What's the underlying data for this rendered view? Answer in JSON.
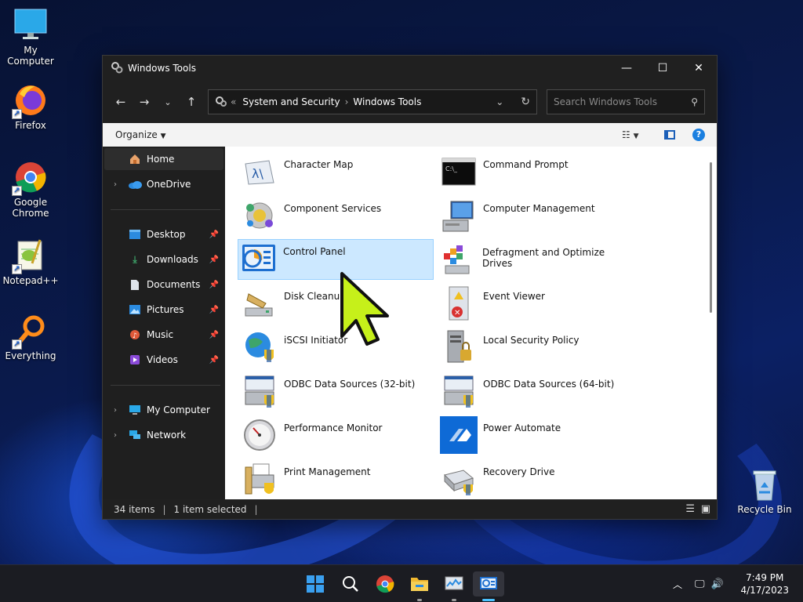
{
  "desktop": {
    "icons": [
      {
        "label": "My Computer"
      },
      {
        "label": "Firefox"
      },
      {
        "label": "Google Chrome"
      },
      {
        "label": "Notepad++"
      },
      {
        "label": "Everything"
      },
      {
        "label": "Recycle Bin"
      }
    ]
  },
  "window": {
    "title": "Windows Tools",
    "address": {
      "prefix": "«",
      "crumbs": [
        "System and Security",
        "Windows Tools"
      ]
    },
    "search_placeholder": "Search Windows Tools",
    "organize_label": "Organize",
    "nav": {
      "home": "Home",
      "onedrive": "OneDrive",
      "desktop": "Desktop",
      "downloads": "Downloads",
      "documents": "Documents",
      "pictures": "Pictures",
      "music": "Music",
      "videos": "Videos",
      "mycomputer": "My Computer",
      "network": "Network"
    },
    "items": [
      {
        "label": "Character Map",
        "icon": "character-map-icon"
      },
      {
        "label": "Command Prompt",
        "icon": "command-prompt-icon"
      },
      {
        "label": "Component Services",
        "icon": "component-services-icon"
      },
      {
        "label": "Computer Management",
        "icon": "computer-management-icon"
      },
      {
        "label": "Control Panel",
        "icon": "control-panel-icon",
        "selected": true
      },
      {
        "label": "Defragment and Optimize Drives",
        "icon": "defragment-icon"
      },
      {
        "label": "Disk Cleanup",
        "icon": "disk-cleanup-icon"
      },
      {
        "label": "Event Viewer",
        "icon": "event-viewer-icon"
      },
      {
        "label": "iSCSI Initiator",
        "icon": "iscsi-initiator-icon"
      },
      {
        "label": "Local Security Policy",
        "icon": "local-security-policy-icon"
      },
      {
        "label": "ODBC Data Sources (32-bit)",
        "icon": "odbc-icon"
      },
      {
        "label": "ODBC Data Sources (64-bit)",
        "icon": "odbc-icon"
      },
      {
        "label": "Performance Monitor",
        "icon": "performance-monitor-icon"
      },
      {
        "label": "Power Automate",
        "icon": "power-automate-icon"
      },
      {
        "label": "Print Management",
        "icon": "print-management-icon"
      },
      {
        "label": "Recovery Drive",
        "icon": "recovery-drive-icon"
      }
    ],
    "status": {
      "count": "34 items",
      "selected": "1 item selected"
    }
  },
  "taskbar": {
    "clock_time": "7:49 PM",
    "clock_date": "4/17/2023"
  },
  "colors": {
    "accent": "#0078d4",
    "selection": "#cce8ff",
    "cursor": "#c6f01a"
  }
}
